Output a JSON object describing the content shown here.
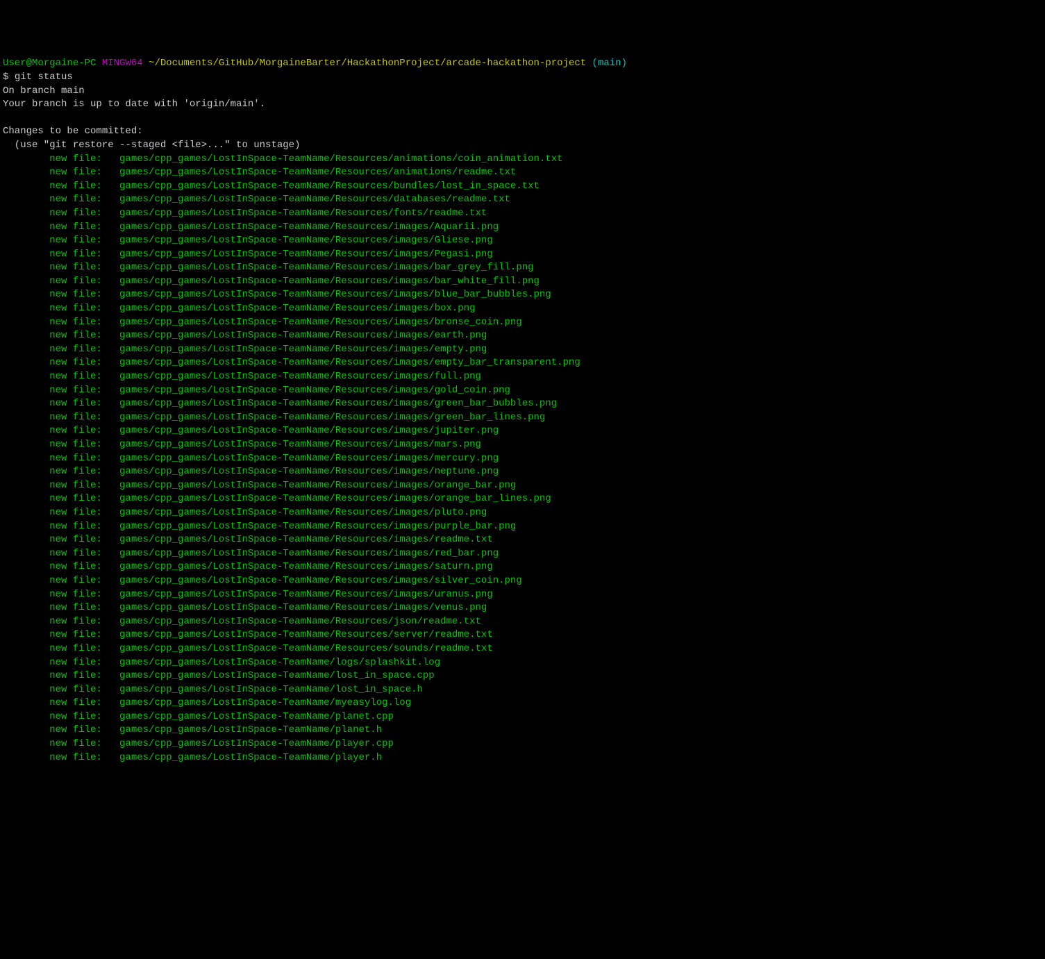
{
  "prompt": {
    "user": "User@Morgaine-PC",
    "shell": " MINGW64",
    "path": " ~/Documents/GitHub/MorgaineBarter/HackathonProject/arcade-hackathon-project",
    "branch_open": " (",
    "branch": "main",
    "branch_close": ")"
  },
  "command_prompt": "$ ",
  "command": "git status",
  "on_branch": "On branch main",
  "up_to_date": "Your branch is up to date with 'origin/main'.",
  "blank": "",
  "changes_header": "Changes to be committed:",
  "unstage_hint": "  (use \"git restore --staged <file>...\" to unstage)",
  "file_prefix": "        new file:   ",
  "files": [
    "games/cpp_games/LostInSpace-TeamName/Resources/animations/coin_animation.txt",
    "games/cpp_games/LostInSpace-TeamName/Resources/animations/readme.txt",
    "games/cpp_games/LostInSpace-TeamName/Resources/bundles/lost_in_space.txt",
    "games/cpp_games/LostInSpace-TeamName/Resources/databases/readme.txt",
    "games/cpp_games/LostInSpace-TeamName/Resources/fonts/readme.txt",
    "games/cpp_games/LostInSpace-TeamName/Resources/images/Aquarii.png",
    "games/cpp_games/LostInSpace-TeamName/Resources/images/Gliese.png",
    "games/cpp_games/LostInSpace-TeamName/Resources/images/Pegasi.png",
    "games/cpp_games/LostInSpace-TeamName/Resources/images/bar_grey_fill.png",
    "games/cpp_games/LostInSpace-TeamName/Resources/images/bar_white_fill.png",
    "games/cpp_games/LostInSpace-TeamName/Resources/images/blue_bar_bubbles.png",
    "games/cpp_games/LostInSpace-TeamName/Resources/images/box.png",
    "games/cpp_games/LostInSpace-TeamName/Resources/images/bronse_coin.png",
    "games/cpp_games/LostInSpace-TeamName/Resources/images/earth.png",
    "games/cpp_games/LostInSpace-TeamName/Resources/images/empty.png",
    "games/cpp_games/LostInSpace-TeamName/Resources/images/empty_bar_transparent.png",
    "games/cpp_games/LostInSpace-TeamName/Resources/images/full.png",
    "games/cpp_games/LostInSpace-TeamName/Resources/images/gold_coin.png",
    "games/cpp_games/LostInSpace-TeamName/Resources/images/green_bar_bubbles.png",
    "games/cpp_games/LostInSpace-TeamName/Resources/images/green_bar_lines.png",
    "games/cpp_games/LostInSpace-TeamName/Resources/images/jupiter.png",
    "games/cpp_games/LostInSpace-TeamName/Resources/images/mars.png",
    "games/cpp_games/LostInSpace-TeamName/Resources/images/mercury.png",
    "games/cpp_games/LostInSpace-TeamName/Resources/images/neptune.png",
    "games/cpp_games/LostInSpace-TeamName/Resources/images/orange_bar.png",
    "games/cpp_games/LostInSpace-TeamName/Resources/images/orange_bar_lines.png",
    "games/cpp_games/LostInSpace-TeamName/Resources/images/pluto.png",
    "games/cpp_games/LostInSpace-TeamName/Resources/images/purple_bar.png",
    "games/cpp_games/LostInSpace-TeamName/Resources/images/readme.txt",
    "games/cpp_games/LostInSpace-TeamName/Resources/images/red_bar.png",
    "games/cpp_games/LostInSpace-TeamName/Resources/images/saturn.png",
    "games/cpp_games/LostInSpace-TeamName/Resources/images/silver_coin.png",
    "games/cpp_games/LostInSpace-TeamName/Resources/images/uranus.png",
    "games/cpp_games/LostInSpace-TeamName/Resources/images/venus.png",
    "games/cpp_games/LostInSpace-TeamName/Resources/json/readme.txt",
    "games/cpp_games/LostInSpace-TeamName/Resources/server/readme.txt",
    "games/cpp_games/LostInSpace-TeamName/Resources/sounds/readme.txt",
    "games/cpp_games/LostInSpace-TeamName/logs/splashkit.log",
    "games/cpp_games/LostInSpace-TeamName/lost_in_space.cpp",
    "games/cpp_games/LostInSpace-TeamName/lost_in_space.h",
    "games/cpp_games/LostInSpace-TeamName/myeasylog.log",
    "games/cpp_games/LostInSpace-TeamName/planet.cpp",
    "games/cpp_games/LostInSpace-TeamName/planet.h",
    "games/cpp_games/LostInSpace-TeamName/player.cpp",
    "games/cpp_games/LostInSpace-TeamName/player.h"
  ]
}
